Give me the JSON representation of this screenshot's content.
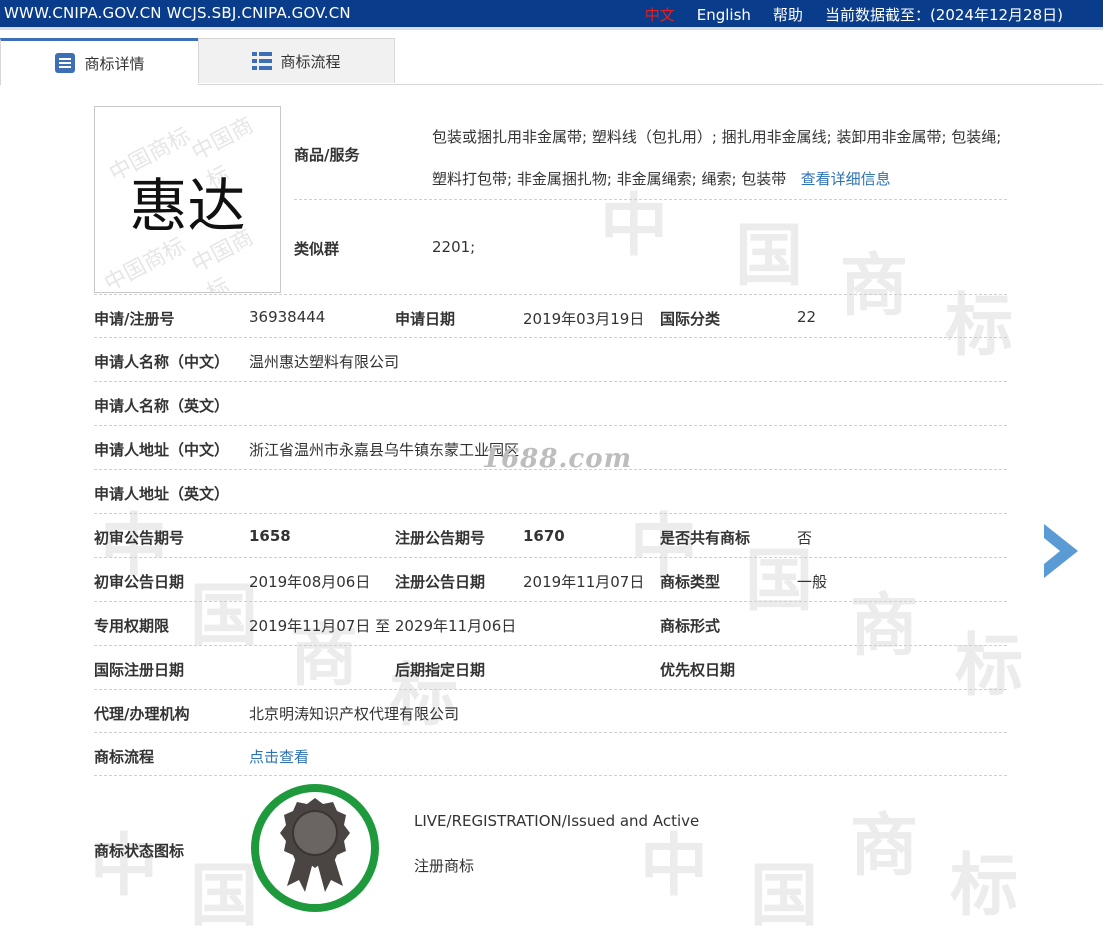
{
  "topbar": {
    "sites": "WWW.CNIPA.GOV.CN WCJS.SBJ.CNIPA.GOV.CN",
    "lang_zh": "中文",
    "lang_en": "English",
    "help": "帮助",
    "data_date": "当前数据截至：(2024年12月28日)"
  },
  "tabs": [
    {
      "label": "商标详情",
      "icon": "list-doc-icon"
    },
    {
      "label": "商标流程",
      "icon": "grid-list-icon"
    }
  ],
  "watermark": {
    "glyphs": [
      "中",
      "国",
      "商",
      "标"
    ],
    "site": "1688.com"
  },
  "trademark": {
    "image_text": "惠达",
    "image_watermark": "中国商标",
    "goods_label": "商品/服务",
    "goods_text": "包装或捆扎用非金属带; 塑料线（包扎用）; 捆扎用非金属线; 装卸用非金属带; 包装绳; 塑料打包带; 非金属捆扎物; 非金属绳索; 绳索; 包装带",
    "goods_link": "查看详细信息",
    "similar_label": "类似群",
    "similar_value": "2201;"
  },
  "rows": {
    "reg_no_label": "申请/注册号",
    "reg_no": "36938444",
    "app_date_label": "申请日期",
    "app_date": "2019年03月19日",
    "intl_class_label": "国际分类",
    "intl_class": "22",
    "applicant_cn_label": "申请人名称（中文）",
    "applicant_cn": "温州惠达塑料有限公司",
    "applicant_en_label": "申请人名称（英文）",
    "address_cn_label": "申请人地址（中文）",
    "address_cn": "浙江省温州市永嘉县乌牛镇东蒙工业园区",
    "address_en_label": "申请人地址（英文）",
    "prelim_no_label": "初审公告期号",
    "prelim_no": "1658",
    "reg_pub_no_label": "注册公告期号",
    "reg_pub_no": "1670",
    "shared_label": "是否共有商标",
    "shared": "否",
    "prelim_date_label": "初审公告日期",
    "prelim_date": "2019年08月06日",
    "reg_pub_date_label": "注册公告日期",
    "reg_pub_date": "2019年11月07日",
    "tm_type_label": "商标类型",
    "tm_type": "一般",
    "excl_period_label": "专用权期限",
    "excl_period": "2019年11月07日 至 2029年11月06日",
    "tm_form_label": "商标形式",
    "intl_reg_date_label": "国际注册日期",
    "later_designation_label": "后期指定日期",
    "priority_date_label": "优先权日期",
    "agent_label": "代理/办理机构",
    "agent": "北京明涛知识产权代理有限公司",
    "flow_label": "商标流程",
    "flow_link": "点击查看",
    "status_label": "商标状态图标",
    "status_en": "LIVE/REGISTRATION/Issued and Active",
    "status_cn": "注册商标"
  },
  "colors": {
    "topbar": "#0a3c8c",
    "link": "#2b72b6",
    "status_ring": "#1e9a3c",
    "arrow": "#5b9bd5"
  }
}
